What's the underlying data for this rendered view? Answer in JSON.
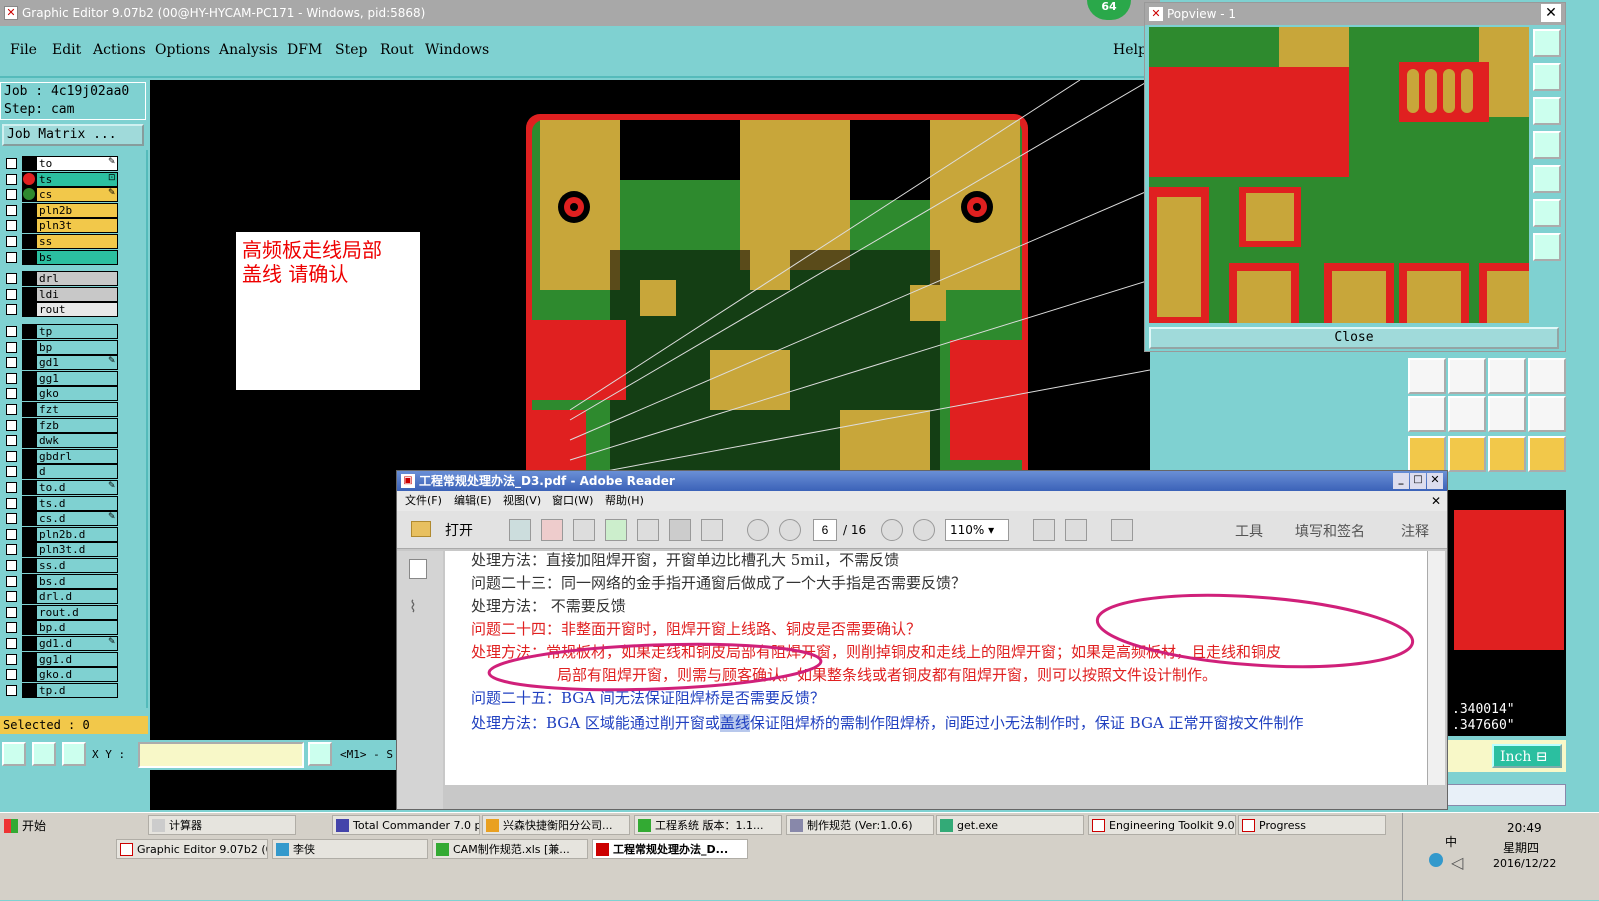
{
  "window": {
    "title": "Graphic Editor 9.07b2 (00@HY-HYCAM-PC171 - Windows, pid:5868)",
    "badge": "64"
  },
  "menu": [
    "File",
    "Edit",
    "Actions",
    "Options",
    "Analysis",
    "DFM",
    "Step",
    "Rout",
    "Windows"
  ],
  "menu_help": "Help",
  "job": {
    "job_line": "Job : 4c19j02aa0",
    "step_line": "Step: cam",
    "matrix_label": "Job Matrix ..."
  },
  "layers": [
    {
      "name": "to",
      "color": "#ffffff",
      "mark": "pencil"
    },
    {
      "name": "ts",
      "color": "#2bbfa0",
      "mark": "arrow"
    },
    {
      "name": "cs",
      "color": "#f2c84a",
      "mark": "pencil"
    },
    {
      "name": "pln2b",
      "color": "#f2c84a"
    },
    {
      "name": "pln3t",
      "color": "#f2c84a"
    },
    {
      "name": "ss",
      "color": "#f2c84a"
    },
    {
      "name": "bs",
      "color": "#2bbfa0"
    },
    {
      "name": "drl",
      "color": "#c8c8c8"
    },
    {
      "name": "ldi",
      "color": "#c8c8c8"
    },
    {
      "name": "rout",
      "color": "#e8e8e8"
    },
    {
      "name": "tp",
      "color": "#7fd1d1"
    },
    {
      "name": "bp",
      "color": "#7fd1d1"
    },
    {
      "name": "gd1",
      "color": "#7fd1d1",
      "mark": "pencil"
    },
    {
      "name": "gg1",
      "color": "#7fd1d1"
    },
    {
      "name": "gko",
      "color": "#7fd1d1"
    },
    {
      "name": "fzt",
      "color": "#7fd1d1"
    },
    {
      "name": "fzb",
      "color": "#7fd1d1"
    },
    {
      "name": "dwk",
      "color": "#7fd1d1"
    },
    {
      "name": "gbdrl",
      "color": "#7fd1d1"
    },
    {
      "name": "d",
      "color": "#7fd1d1"
    },
    {
      "name": "to.d",
      "color": "#7fd1d1",
      "mark": "pencil"
    },
    {
      "name": "ts.d",
      "color": "#7fd1d1"
    },
    {
      "name": "cs.d",
      "color": "#7fd1d1",
      "mark": "pencil"
    },
    {
      "name": "pln2b.d",
      "color": "#7fd1d1"
    },
    {
      "name": "pln3t.d",
      "color": "#7fd1d1"
    },
    {
      "name": "ss.d",
      "color": "#7fd1d1"
    },
    {
      "name": "bs.d",
      "color": "#7fd1d1"
    },
    {
      "name": "drl.d",
      "color": "#7fd1d1"
    },
    {
      "name": "rout.d",
      "color": "#7fd1d1"
    },
    {
      "name": "bp.d",
      "color": "#7fd1d1"
    },
    {
      "name": "gd1.d",
      "color": "#7fd1d1",
      "mark": "pencil"
    },
    {
      "name": "gg1.d",
      "color": "#7fd1d1"
    },
    {
      "name": "gko.d",
      "color": "#7fd1d1"
    },
    {
      "name": "tp.d",
      "color": "#7fd1d1"
    }
  ],
  "selected": "Selected : 0",
  "xy_label": "X Y :",
  "mode_text": "<M1> - S",
  "note": {
    "line1": "高频板走线局部",
    "line2": "盖线    请确认"
  },
  "popview": {
    "title": "Popview - 1",
    "close": "Close"
  },
  "coords": {
    "x": ".340014\"",
    "y": ".347660\""
  },
  "units": "Inch",
  "reader": {
    "title": "工程常规处理办法_D3.pdf - Adobe Reader",
    "menu": [
      "文件(F)",
      "编辑(E)",
      "视图(V)",
      "窗口(W)",
      "帮助(H)"
    ],
    "open": "打开",
    "page": "6",
    "pages": "/ 16",
    "zoom": "110%",
    "tools": "工具",
    "fill_sign": "填写和签名",
    "comment": "注释",
    "lines": [
      {
        "text": "处理方法：直接加阻焊开窗，开窗单边比槽孔大 5mil，不需反馈",
        "color": "#333333"
      },
      {
        "text": "问题二十三：同一网络的金手指开通窗后做成了一个大手指是否需要反馈？",
        "color": "#333333"
      },
      {
        "text": "处理方法：  不需要反馈",
        "color": "#333333"
      },
      {
        "text": "问题二十四：非整面开窗时，阻焊开窗上线路、铜皮是否需要确认？",
        "color": "#e02020"
      },
      {
        "text": "处理方法：常规板材，如果走线和铜皮局部有阻焊开窗，则削掉铜皮和走线上的阻焊开窗；如果是高频板材，且走线和铜皮",
        "color": "#e02020"
      },
      {
        "text": "局部有阻焊开窗，则需与顾客确认。如果整条线或者铜皮都有阻焊开窗，则可以按照文件设计制作。",
        "color": "#e02020"
      },
      {
        "text": "问题二十五：BGA 间无法保证阻焊桥是否需要反馈？",
        "color": "#2040c0"
      },
      {
        "text": "处理方法：BGA 区域能通过削开窗或",
        "color": "#2040c0"
      }
    ],
    "highlight": "盖线",
    "line8_tail": "保证阻焊桥的需制作阻焊桥，间距过小无法制作时，保证 BGA 正常开窗按文件制作"
  },
  "taskbar": {
    "start": "开始",
    "tasks_row1": [
      "计算器",
      "Total Commander 7.0 p...",
      "兴森快捷衡阳分公司...",
      "工程系统  版本：1.1...",
      "制作规范 (Ver:1.0.6)",
      "get.exe",
      "Engineering Toolkit 9.0...",
      "Progress"
    ],
    "tasks_row2": [
      "Graphic Editor 9.07b2 (0...",
      "李侠",
      "CAM制作规范.xls [兼...",
      "工程常规处理办法_D..."
    ],
    "ime": "中",
    "time": "20:49",
    "weekday": "星期四",
    "date": "2016/12/22"
  }
}
